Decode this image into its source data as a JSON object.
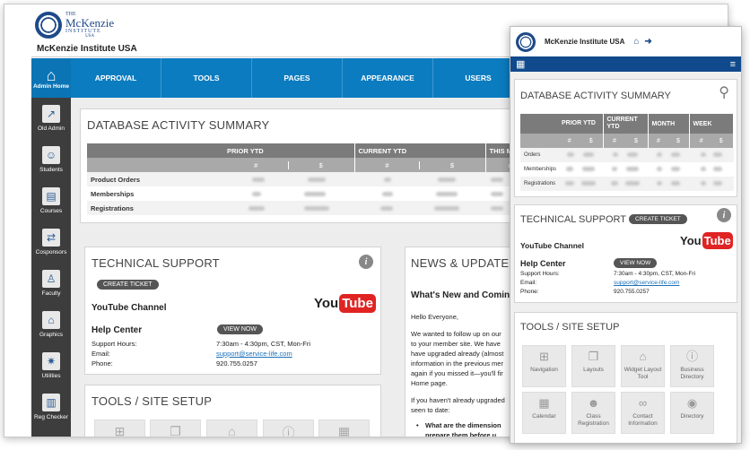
{
  "desktop": {
    "brand": {
      "the": "THE",
      "name": "McKenzie",
      "institute": "INSTITUTE",
      "usa": "USA"
    },
    "site_title": "McKenzie Institute USA",
    "sidebar": [
      {
        "label": "Admin Home",
        "icon": "home-icon"
      },
      {
        "label": "Old Admin",
        "icon": "external-link-icon"
      },
      {
        "label": "Students",
        "icon": "person-icon"
      },
      {
        "label": "Courses",
        "icon": "book-icon"
      },
      {
        "label": "Cosponsors",
        "icon": "sliders-icon"
      },
      {
        "label": "Faculty",
        "icon": "faculty-icon"
      },
      {
        "label": "Graphics",
        "icon": "house-graphic-icon"
      },
      {
        "label": "Utilities",
        "icon": "gear-icon"
      },
      {
        "label": "Reg Checker",
        "icon": "reg-checker-icon"
      }
    ],
    "topnav": [
      "APPROVAL",
      "TOOLS",
      "PAGES",
      "APPEARANCE",
      "USERS"
    ],
    "db_summary": {
      "title": "DATABASE ACTIVITY SUMMARY",
      "col_groups": [
        "PRIOR YTD",
        "CURRENT YTD",
        "THIS M"
      ],
      "sub": [
        "#",
        "$",
        "#",
        "$",
        "#"
      ],
      "rows": [
        "Product Orders",
        "Memberships",
        "Registrations"
      ]
    },
    "tech_support": {
      "title": "TECHNICAL SUPPORT",
      "create_ticket": "CREATE TICKET",
      "youtube_label": "YouTube Channel",
      "yt_you": "You",
      "yt_tube": "Tube",
      "help_center": "Help Center",
      "view_now": "VIEW NOW",
      "hours_label": "Support Hours:",
      "hours_value": "7:30am - 4:30pm, CST, Mon-Fri",
      "email_label": "Email:",
      "email_value": "support@service-life.com",
      "phone_label": "Phone:",
      "phone_value": "920.755.0257"
    },
    "tools_title": "TOOLS / SITE SETUP",
    "news": {
      "title": "NEWS & UPDATES",
      "subtitle": "What's New and Comin",
      "p1": "Hello Everyone,",
      "p2_lines": [
        "We wanted to follow up on our",
        "to your member site. We have",
        "have upgraded already (almost",
        "information in the previous mer",
        "again if you missed it—you'll fir",
        "Home page."
      ],
      "p3_lines": [
        "If you haven't already upgraded",
        "seen to date:"
      ],
      "bullet_lines": [
        "What are the dimension",
        "prepare them before u"
      ]
    }
  },
  "mobile": {
    "site_title": "McKenzie Institute USA",
    "db_summary": {
      "title": "DATABASE ACTIVITY SUMMARY",
      "col_groups": [
        "PRIOR YTD",
        "CURRENT YTD",
        "MONTH",
        "WEEK"
      ],
      "sub": [
        "#",
        "$",
        "#",
        "$",
        "#",
        "$",
        "#",
        "$"
      ],
      "rows": [
        "Orders",
        "Memberships",
        "Registrations"
      ]
    },
    "tech_support": {
      "title": "TECHNICAL SUPPORT",
      "create_ticket": "CREATE TICKET",
      "youtube_label": "YouTube Channel",
      "help_center": "Help Center",
      "view_now": "VIEW NOW",
      "hours_label": "Support Hours:",
      "hours_value": "7:30am - 4:30pm, CST, Mon-Fri",
      "email_label": "Email:",
      "email_value": "support@service-life.com",
      "phone_label": "Phone:",
      "phone_value": "920.755.0257"
    },
    "tools_title": "TOOLS / SITE SETUP",
    "tools": [
      {
        "label": "Navigation",
        "icon": "sitemap-icon"
      },
      {
        "label": "Layouts",
        "icon": "layouts-icon"
      },
      {
        "label": "Widget Layout Tool",
        "icon": "house-icon"
      },
      {
        "label": "Business Directory",
        "icon": "info-icon"
      },
      {
        "label": "Calendar",
        "icon": "calendar-icon"
      },
      {
        "label": "Class Registration",
        "icon": "users-icon"
      },
      {
        "label": "Contact Information",
        "icon": "link-icon"
      },
      {
        "label": "Directory",
        "icon": "eye-icon"
      }
    ]
  },
  "colors": {
    "nav_blue": "#0c7cc0",
    "sidebar_dark": "#3d3d3d",
    "mobile_bar": "#114a8c",
    "youtube_red": "#e02424"
  }
}
